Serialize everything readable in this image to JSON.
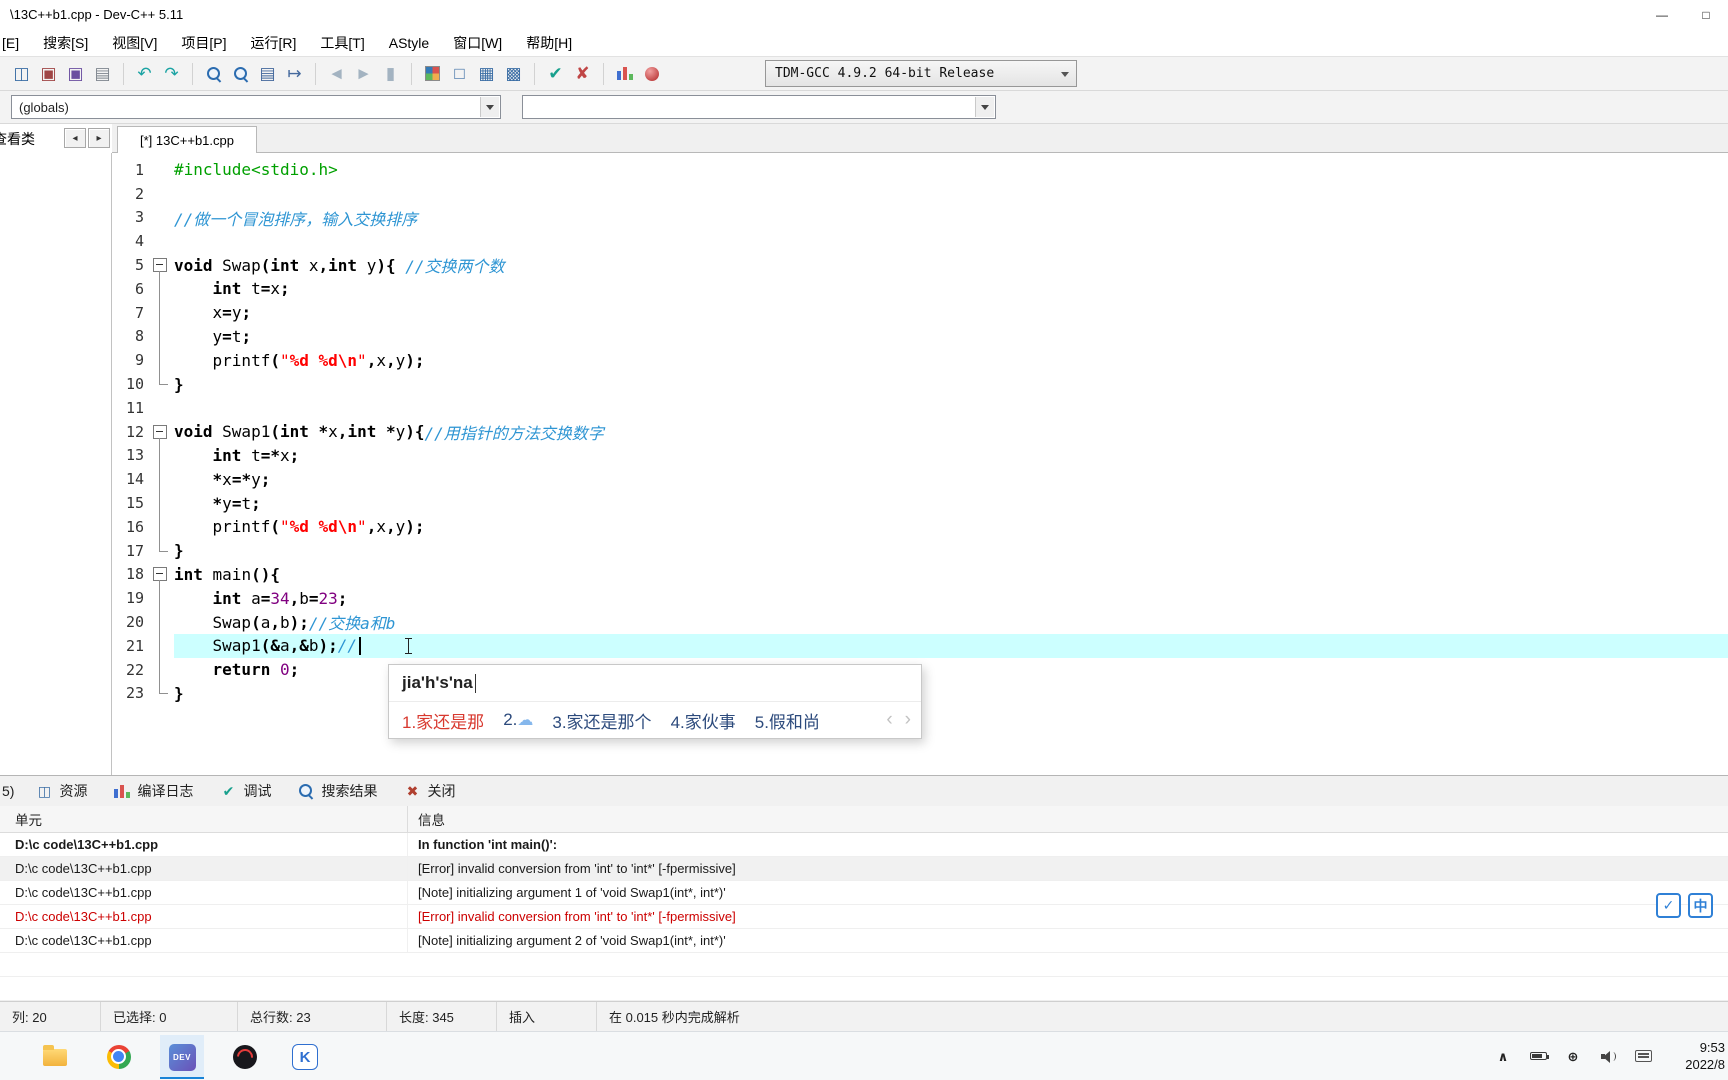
{
  "window": {
    "title": "\\13C++b1.cpp - Dev-C++ 5.11",
    "minimize_glyph": "—",
    "maximize_glyph": "□"
  },
  "menu": {
    "items": [
      "[E]",
      "搜索[S]",
      "视图[V]",
      "项目[P]",
      "运行[R]",
      "工具[T]",
      "AStyle",
      "窗口[W]",
      "帮助[H]"
    ]
  },
  "toolbar": {
    "compiler": "TDM-GCC 4.9.2 64-bit Release",
    "groups": [
      [
        {
          "name": "new-window-icon",
          "glyph": "◫",
          "color": "#3b6ea5"
        },
        {
          "name": "open-project-icon",
          "glyph": "▣",
          "color": "#a04545"
        },
        {
          "name": "save-icon",
          "glyph": "▣",
          "color": "#6b4fa0"
        },
        {
          "name": "print-icon",
          "glyph": "▤",
          "color": "#7f868e"
        }
      ],
      [
        {
          "name": "undo-icon",
          "glyph": "↶",
          "color": "#1ba3a3"
        },
        {
          "name": "redo-icon",
          "glyph": "↷",
          "color": "#1ba3a3"
        }
      ],
      [
        {
          "name": "find-icon",
          "kind": "mag"
        },
        {
          "name": "find-next-icon",
          "kind": "mag"
        },
        {
          "name": "goto-line-icon",
          "glyph": "▤",
          "color": "#44699d"
        },
        {
          "name": "goto-definition-icon",
          "glyph": "↦",
          "color": "#44699d"
        }
      ],
      [
        {
          "name": "compile-icon",
          "glyph": "◄",
          "color": "#9fb0bf",
          "disabled": true
        },
        {
          "name": "run-icon",
          "glyph": "►",
          "color": "#9fb0bf",
          "disabled": true
        },
        {
          "name": "compile-run-icon",
          "glyph": "▮",
          "color": "#9fb0bf",
          "disabled": true
        }
      ],
      [
        {
          "name": "rebuild-all-icon",
          "kind": "quad"
        },
        {
          "name": "new-source-icon",
          "glyph": "□",
          "color": "#3b6ea5"
        },
        {
          "name": "project-options-icon",
          "glyph": "▦",
          "color": "#3b6ea5"
        },
        {
          "name": "package-manager-icon",
          "glyph": "▩",
          "color": "#3b6ea5"
        }
      ],
      [
        {
          "name": "syntax-check-icon",
          "glyph": "✔",
          "color": "#18a08d"
        },
        {
          "name": "abort-compile-icon",
          "glyph": "✘",
          "color": "#c04545"
        }
      ],
      [
        {
          "name": "profile-icon",
          "kind": "bars"
        },
        {
          "name": "profiling-delete-icon",
          "kind": "ball"
        }
      ]
    ]
  },
  "symbols_bar": {
    "globals": "(globals)",
    "members": ""
  },
  "left_panel": {
    "tab_label": "查看类",
    "scroll_left_glyph": "◂",
    "scroll_right_glyph": "▸"
  },
  "editor": {
    "tab_label": "[*] 13C++b1.cpp",
    "current_line": 21,
    "colors": {
      "preprocessor": "#00a000",
      "comment": "#2e95d3",
      "string": "#ff0000",
      "number": "#800080",
      "current_line_highlight": "#ccffff"
    },
    "lines": [
      {
        "n": 1,
        "fold": "",
        "tokens": [
          [
            "g",
            "#include<stdio.h>"
          ]
        ]
      },
      {
        "n": 2,
        "fold": "",
        "tokens": []
      },
      {
        "n": 3,
        "fold": "",
        "tokens": [
          [
            "c",
            "//做一个冒泡排序，输入交换排序"
          ]
        ]
      },
      {
        "n": 4,
        "fold": "",
        "tokens": []
      },
      {
        "n": 5,
        "fold": "s",
        "tokens": [
          [
            "k",
            "void"
          ],
          [
            "p",
            " Swap"
          ],
          [
            "y",
            "("
          ],
          [
            "k",
            "int"
          ],
          [
            "p",
            " x"
          ],
          [
            "y",
            ","
          ],
          [
            "k",
            "int"
          ],
          [
            "p",
            " y"
          ],
          [
            "y",
            "){"
          ],
          [
            "p",
            " "
          ],
          [
            "c",
            "//交换两个数"
          ]
        ]
      },
      {
        "n": 6,
        "fold": "m",
        "tokens": [
          [
            "p",
            "    "
          ],
          [
            "k",
            "int"
          ],
          [
            "p",
            " t"
          ],
          [
            "y",
            "="
          ],
          [
            "p",
            "x"
          ],
          [
            "y",
            ";"
          ]
        ]
      },
      {
        "n": 7,
        "fold": "m",
        "tokens": [
          [
            "p",
            "    x"
          ],
          [
            "y",
            "="
          ],
          [
            "p",
            "y"
          ],
          [
            "y",
            ";"
          ]
        ]
      },
      {
        "n": 8,
        "fold": "m",
        "tokens": [
          [
            "p",
            "    y"
          ],
          [
            "y",
            "="
          ],
          [
            "p",
            "t"
          ],
          [
            "y",
            ";"
          ]
        ]
      },
      {
        "n": 9,
        "fold": "m",
        "tokens": [
          [
            "p",
            "    printf"
          ],
          [
            "y",
            "("
          ],
          [
            "s",
            "\""
          ],
          [
            "f",
            "%d"
          ],
          [
            "s",
            " "
          ],
          [
            "f",
            "%d"
          ],
          [
            "f",
            "\\n"
          ],
          [
            "s",
            "\""
          ],
          [
            "y",
            ","
          ],
          [
            "p",
            "x"
          ],
          [
            "y",
            ","
          ],
          [
            "p",
            "y"
          ],
          [
            "y",
            ");"
          ]
        ]
      },
      {
        "n": 10,
        "fold": "e",
        "tokens": [
          [
            "y",
            "}"
          ]
        ]
      },
      {
        "n": 11,
        "fold": "",
        "tokens": []
      },
      {
        "n": 12,
        "fold": "s",
        "tokens": [
          [
            "k",
            "void"
          ],
          [
            "p",
            " Swap1"
          ],
          [
            "y",
            "("
          ],
          [
            "k",
            "int"
          ],
          [
            "p",
            " "
          ],
          [
            "y",
            "*"
          ],
          [
            "p",
            "x"
          ],
          [
            "y",
            ","
          ],
          [
            "k",
            "int"
          ],
          [
            "p",
            " "
          ],
          [
            "y",
            "*"
          ],
          [
            "p",
            "y"
          ],
          [
            "y",
            "){"
          ],
          [
            "c",
            "//用指针的方法交换数字"
          ]
        ]
      },
      {
        "n": 13,
        "fold": "m",
        "tokens": [
          [
            "p",
            "    "
          ],
          [
            "k",
            "int"
          ],
          [
            "p",
            " t"
          ],
          [
            "y",
            "=*"
          ],
          [
            "p",
            "x"
          ],
          [
            "y",
            ";"
          ]
        ]
      },
      {
        "n": 14,
        "fold": "m",
        "tokens": [
          [
            "p",
            "    "
          ],
          [
            "y",
            "*"
          ],
          [
            "p",
            "x"
          ],
          [
            "y",
            "=*"
          ],
          [
            "p",
            "y"
          ],
          [
            "y",
            ";"
          ]
        ]
      },
      {
        "n": 15,
        "fold": "m",
        "tokens": [
          [
            "p",
            "    "
          ],
          [
            "y",
            "*"
          ],
          [
            "p",
            "y"
          ],
          [
            "y",
            "="
          ],
          [
            "p",
            "t"
          ],
          [
            "y",
            ";"
          ]
        ]
      },
      {
        "n": 16,
        "fold": "m",
        "tokens": [
          [
            "p",
            "    printf"
          ],
          [
            "y",
            "("
          ],
          [
            "s",
            "\""
          ],
          [
            "f",
            "%d"
          ],
          [
            "s",
            " "
          ],
          [
            "f",
            "%d"
          ],
          [
            "f",
            "\\n"
          ],
          [
            "s",
            "\""
          ],
          [
            "y",
            ","
          ],
          [
            "p",
            "x"
          ],
          [
            "y",
            ","
          ],
          [
            "p",
            "y"
          ],
          [
            "y",
            ");"
          ]
        ]
      },
      {
        "n": 17,
        "fold": "e",
        "tokens": [
          [
            "y",
            "}"
          ]
        ]
      },
      {
        "n": 18,
        "fold": "s",
        "tokens": [
          [
            "k",
            "int"
          ],
          [
            "p",
            " main"
          ],
          [
            "y",
            "(){"
          ]
        ]
      },
      {
        "n": 19,
        "fold": "m",
        "tokens": [
          [
            "p",
            "    "
          ],
          [
            "k",
            "int"
          ],
          [
            "p",
            " a"
          ],
          [
            "y",
            "="
          ],
          [
            "n",
            "34"
          ],
          [
            "y",
            ","
          ],
          [
            "p",
            "b"
          ],
          [
            "y",
            "="
          ],
          [
            "n",
            "23"
          ],
          [
            "y",
            ";"
          ]
        ]
      },
      {
        "n": 20,
        "fold": "m",
        "tokens": [
          [
            "p",
            "    Swap"
          ],
          [
            "y",
            "("
          ],
          [
            "p",
            "a"
          ],
          [
            "y",
            ","
          ],
          [
            "p",
            "b"
          ],
          [
            "y",
            ");"
          ],
          [
            "c",
            "//交换a和b"
          ]
        ]
      },
      {
        "n": 21,
        "fold": "m",
        "caret": true,
        "tokens": [
          [
            "p",
            "    Swap1"
          ],
          [
            "y",
            "(&"
          ],
          [
            "p",
            "a"
          ],
          [
            "y",
            ",&"
          ],
          [
            "p",
            "b"
          ],
          [
            "y",
            ");"
          ],
          [
            "c",
            "//"
          ]
        ]
      },
      {
        "n": 22,
        "fold": "m",
        "tokens": [
          [
            "p",
            "    "
          ],
          [
            "k",
            "return"
          ],
          [
            "p",
            " "
          ],
          [
            "n",
            "0"
          ],
          [
            "y",
            ";"
          ]
        ]
      },
      {
        "n": 23,
        "fold": "e",
        "tokens": [
          [
            "y",
            "}"
          ]
        ]
      }
    ]
  },
  "ime": {
    "composition": "jia'h's'na",
    "candidates": [
      {
        "label": "1.家还是那",
        "highlight": true
      },
      {
        "label": "2.",
        "cloud": "☁"
      },
      {
        "label": "3.家还是那个"
      },
      {
        "label": "4.家伙事"
      },
      {
        "label": "5.假和尚"
      }
    ],
    "pager_prev": "‹",
    "pager_next": "›"
  },
  "bottom_panel": {
    "cut_label": "5)",
    "tabs": [
      {
        "name": "tab-resources",
        "icon": {
          "glyph": "◫",
          "color": "#3b6ea5"
        },
        "label": "资源"
      },
      {
        "name": "tab-compile-log",
        "icon": {
          "kind": "bars"
        },
        "label": "编译日志"
      },
      {
        "name": "tab-debug",
        "icon": {
          "glyph": "✔",
          "color": "#18a08d"
        },
        "label": "调试"
      },
      {
        "name": "tab-search-results",
        "icon": {
          "kind": "mag"
        },
        "label": "搜索结果"
      },
      {
        "name": "tab-close",
        "icon": {
          "glyph": "✖",
          "color": "#b04030"
        },
        "label": "关闭"
      }
    ],
    "columns": {
      "unit": "单元",
      "info": "信息"
    },
    "rows": [
      {
        "unit": "D:\\c code\\13C++b1.cpp",
        "message": "In function 'int main()':",
        "style": "bold"
      },
      {
        "unit": "D:\\c code\\13C++b1.cpp",
        "message": "[Error] invalid conversion from 'int' to 'int*' [-fpermissive]",
        "style": "shaded"
      },
      {
        "unit": "D:\\c code\\13C++b1.cpp",
        "message": "[Note] initializing argument 1 of 'void Swap1(int*, int*)'",
        "style": "normal"
      },
      {
        "unit": "D:\\c code\\13C++b1.cpp",
        "message": "[Error] invalid conversion from 'int' to 'int*' [-fpermissive]",
        "style": "error"
      },
      {
        "unit": "D:\\c code\\13C++b1.cpp",
        "message": "[Note] initializing argument 2 of 'void Swap1(int*, int*)'",
        "style": "normal"
      }
    ]
  },
  "ime_float": {
    "check_glyph": "✓",
    "lang_glyph": "中"
  },
  "status_bar": {
    "items": [
      "列:   20",
      "已选择:   0",
      "总行数:   23",
      "长度:   345",
      "插入",
      "在 0.015 秒内完成解析"
    ]
  },
  "taskbar": {
    "dev_label": "DEV",
    "k_label": "K",
    "time": "9:53",
    "date": "2022/8",
    "tray": [
      {
        "name": "hidden-icons-chevron",
        "kind": "glyph",
        "glyph": "∧"
      },
      {
        "name": "battery-icon",
        "kind": "bat"
      },
      {
        "name": "network-icon",
        "kind": "glyph",
        "glyph": "⊕"
      },
      {
        "name": "volume-icon",
        "kind": "spk"
      },
      {
        "name": "ime-keyboard-icon",
        "kind": "kbd"
      }
    ]
  }
}
